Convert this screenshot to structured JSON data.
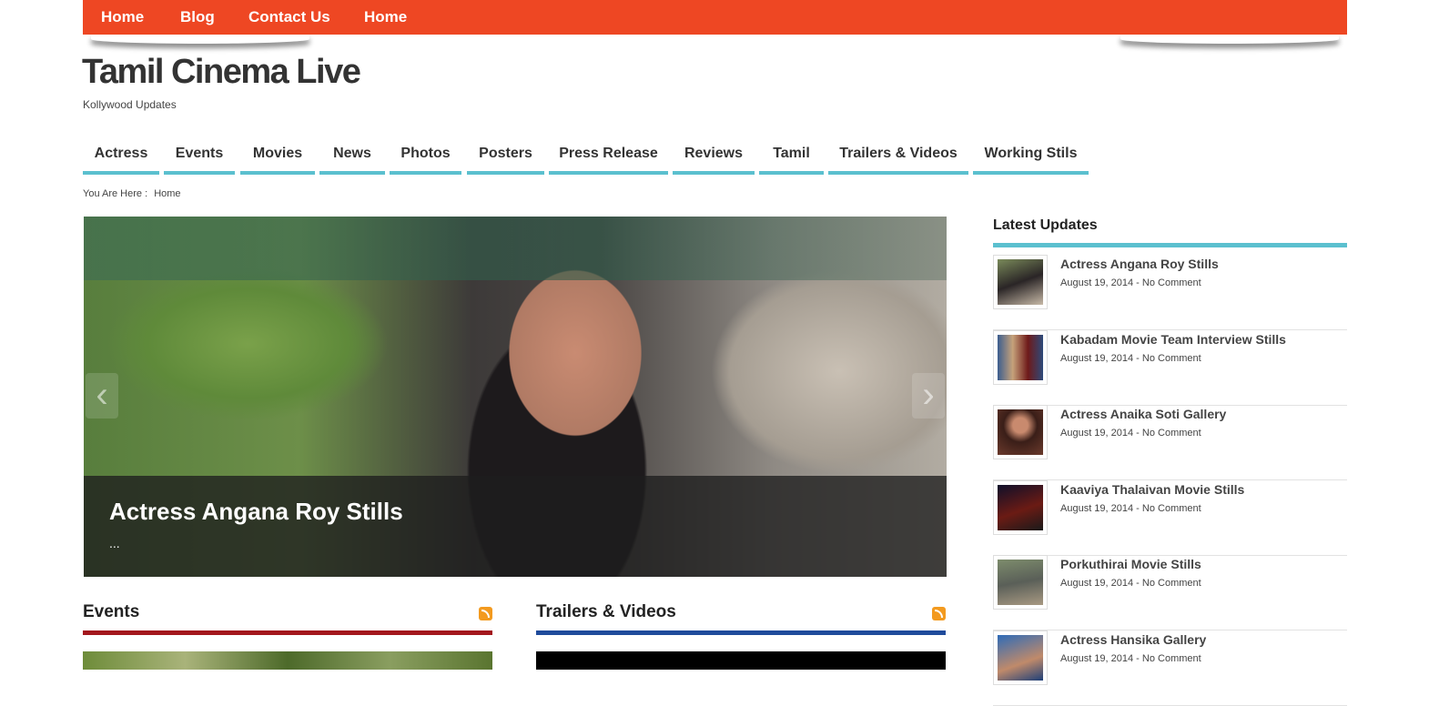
{
  "top_nav": [
    "Home",
    "Blog",
    "Contact Us",
    "Home"
  ],
  "site": {
    "title": "Tamil Cinema Live",
    "tagline": "Kollywood Updates"
  },
  "main_nav": [
    "Actress",
    "Events",
    "Movies",
    "News",
    "Photos",
    "Posters",
    "Press Release",
    "Reviews",
    "Tamil",
    "Trailers & Videos",
    "Working Stils"
  ],
  "breadcrumb": {
    "label": "You Are Here :",
    "current": "Home"
  },
  "slider": {
    "title": "Actress Angana Roy Stills",
    "excerpt": "...",
    "prev_icon": "arrow-left-icon",
    "next_icon": "arrow-right-icon"
  },
  "sections": [
    {
      "title": "Events",
      "color": "#a3171d"
    },
    {
      "title": "Trailers & Videos",
      "color": "#1f4b9b"
    }
  ],
  "sidebar": {
    "title": "Latest Updates",
    "items": [
      {
        "title": "Actress Angana Roy Stills",
        "meta": "August 19, 2014 - No Comment"
      },
      {
        "title": "Kabadam Movie Team Interview Stills",
        "meta": "August 19, 2014 - No Comment"
      },
      {
        "title": "Actress Anaika Soti Gallery",
        "meta": "August 19, 2014 - No Comment"
      },
      {
        "title": "Kaaviya Thalaivan Movie Stills",
        "meta": "August 19, 2014 - No Comment"
      },
      {
        "title": "Porkuthirai Movie Stills",
        "meta": "August 19, 2014 - No Comment"
      },
      {
        "title": "Actress Hansika Gallery",
        "meta": "August 19, 2014 - No Comment"
      }
    ]
  },
  "colors": {
    "top_nav": "#ee4723",
    "accent": "#5bc0cf"
  }
}
